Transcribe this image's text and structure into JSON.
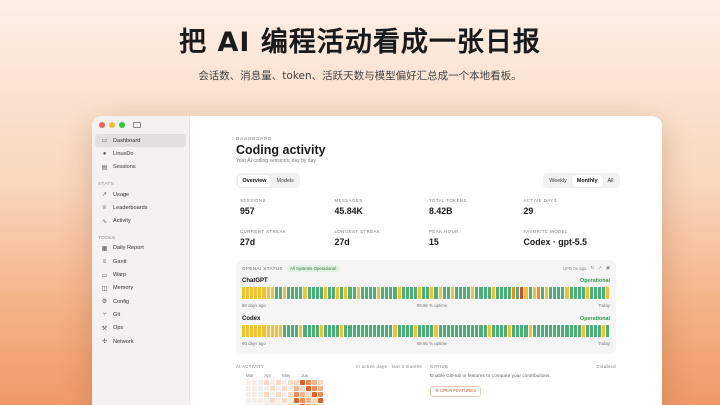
{
  "headline": "把 AI 编程活动看成一张日报",
  "subline": "会话数、消息量、token、活跃天数与模型偏好汇总成一个本地看板。",
  "sidebar": {
    "items_top": [
      {
        "label": "Dashboard",
        "icon": "dashboard-icon",
        "glyph": "▭",
        "active": true
      },
      {
        "label": "LinuxDo",
        "icon": "linuxdo-icon",
        "glyph": "●",
        "active": false
      },
      {
        "label": "Sessions",
        "icon": "sessions-icon",
        "glyph": "▤",
        "active": false
      }
    ],
    "stats_label": "STATS",
    "items_stats": [
      {
        "label": "Usage",
        "icon": "usage-icon",
        "glyph": "↗"
      },
      {
        "label": "Leaderboards",
        "icon": "trophy-icon",
        "glyph": "♕"
      },
      {
        "label": "Activity",
        "icon": "activity-icon",
        "glyph": "∿"
      }
    ],
    "tools_label": "TOOLS",
    "items_tools": [
      {
        "label": "Daily Report",
        "icon": "calendar-icon",
        "glyph": "▦"
      },
      {
        "label": "Gantt",
        "icon": "gantt-icon",
        "glyph": "≡"
      },
      {
        "label": "Warp",
        "icon": "warp-icon",
        "glyph": "▭"
      },
      {
        "label": "Memory",
        "icon": "memory-icon",
        "glyph": "◫"
      },
      {
        "label": "Config",
        "icon": "config-icon",
        "glyph": "⚙"
      },
      {
        "label": "Git",
        "icon": "git-icon",
        "glyph": "⑂"
      },
      {
        "label": "Ops",
        "icon": "ops-icon",
        "glyph": "⚒"
      },
      {
        "label": "Network",
        "icon": "network-icon",
        "glyph": "✣"
      }
    ]
  },
  "main": {
    "kicker": "DASHBOARD",
    "title": "Coding activity",
    "subtitle": "Your AI coding sessions, day by day.",
    "tabs": [
      {
        "label": "Overview",
        "on": true
      },
      {
        "label": "Models",
        "on": false
      }
    ],
    "ranges": [
      {
        "label": "Weekly",
        "on": false
      },
      {
        "label": "Monthly",
        "on": true
      },
      {
        "label": "All",
        "on": false
      }
    ],
    "stats": [
      {
        "label": "SESSIONS",
        "value": "957"
      },
      {
        "label": "MESSAGES",
        "value": "45.84K"
      },
      {
        "label": "TOTAL TOKENS",
        "value": "8.42B"
      },
      {
        "label": "ACTIVE DAYS",
        "value": "29"
      },
      {
        "label": "CURRENT STREAK",
        "value": "27d"
      },
      {
        "label": "LONGEST STREAK",
        "value": "27d"
      },
      {
        "label": "PEAK HOUR",
        "value": "15"
      },
      {
        "label": "FAVORITE MODEL",
        "value": "Codex · gpt-5.5"
      }
    ],
    "status": {
      "label": "OPENAI STATUS",
      "badge": "All Systems Operational",
      "updated": "UPD 0s ago",
      "services": [
        {
          "name": "ChatGPT",
          "state": "Operational",
          "left": "90 days ago",
          "uptime": "99.86 % uptime",
          "right": "Today"
        },
        {
          "name": "Codex",
          "state": "Operational",
          "left": "90 days ago",
          "uptime": "99.96 % uptime",
          "right": "Today"
        }
      ]
    },
    "ai_activity": {
      "label": "AI ACTIVITY",
      "meta": "in active days · last 3 months",
      "months": [
        "Mar",
        "Apr",
        "May",
        "Jun"
      ]
    },
    "github": {
      "label": "GITHUB",
      "meta": "Disabled",
      "text": "Enable GitHub in features to compare your contributions.",
      "button": "OPEN FEATURES"
    }
  },
  "colors": {
    "green": "#4caf7a",
    "yellow": "#f2c12e",
    "orange": "#f08a24",
    "red": "#d9453a",
    "accent": "#c25a2a"
  }
}
